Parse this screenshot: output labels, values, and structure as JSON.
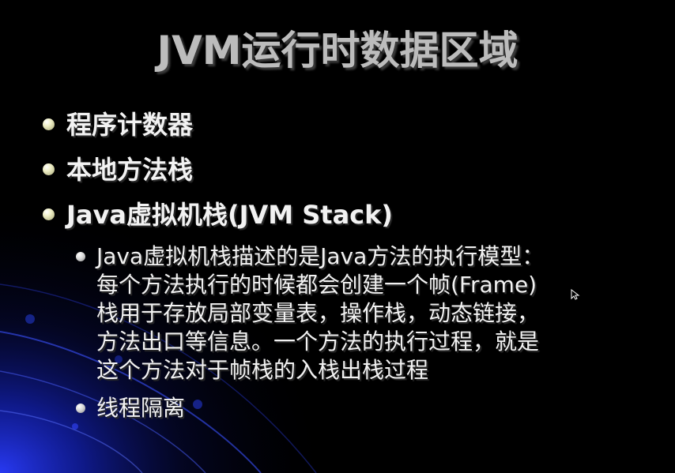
{
  "slide": {
    "title": "JVM运行时数据区域",
    "bullets": [
      {
        "label": "程序计数器"
      },
      {
        "label": "本地方法栈"
      },
      {
        "label": "Java虚拟机栈(JVM Stack)"
      }
    ],
    "sub_bullets": [
      {
        "lines": [
          "Java虚拟机栈描述的是Java方法的执行模型：",
          "每个方法执行的时候都会创建一个帧(Frame)",
          "栈用于存放局部变量表，操作栈，动态链接，",
          "方法出口等信息。一个方法的执行过程，就是",
          "这个方法对于帧栈的入栈出栈过程"
        ]
      },
      {
        "lines": [
          "线程隔离"
        ]
      }
    ]
  },
  "colors": {
    "background": "#000000",
    "title": "#bcbcbc",
    "text": "#f2f2f2",
    "accent_blue": "#1a2aa8"
  }
}
